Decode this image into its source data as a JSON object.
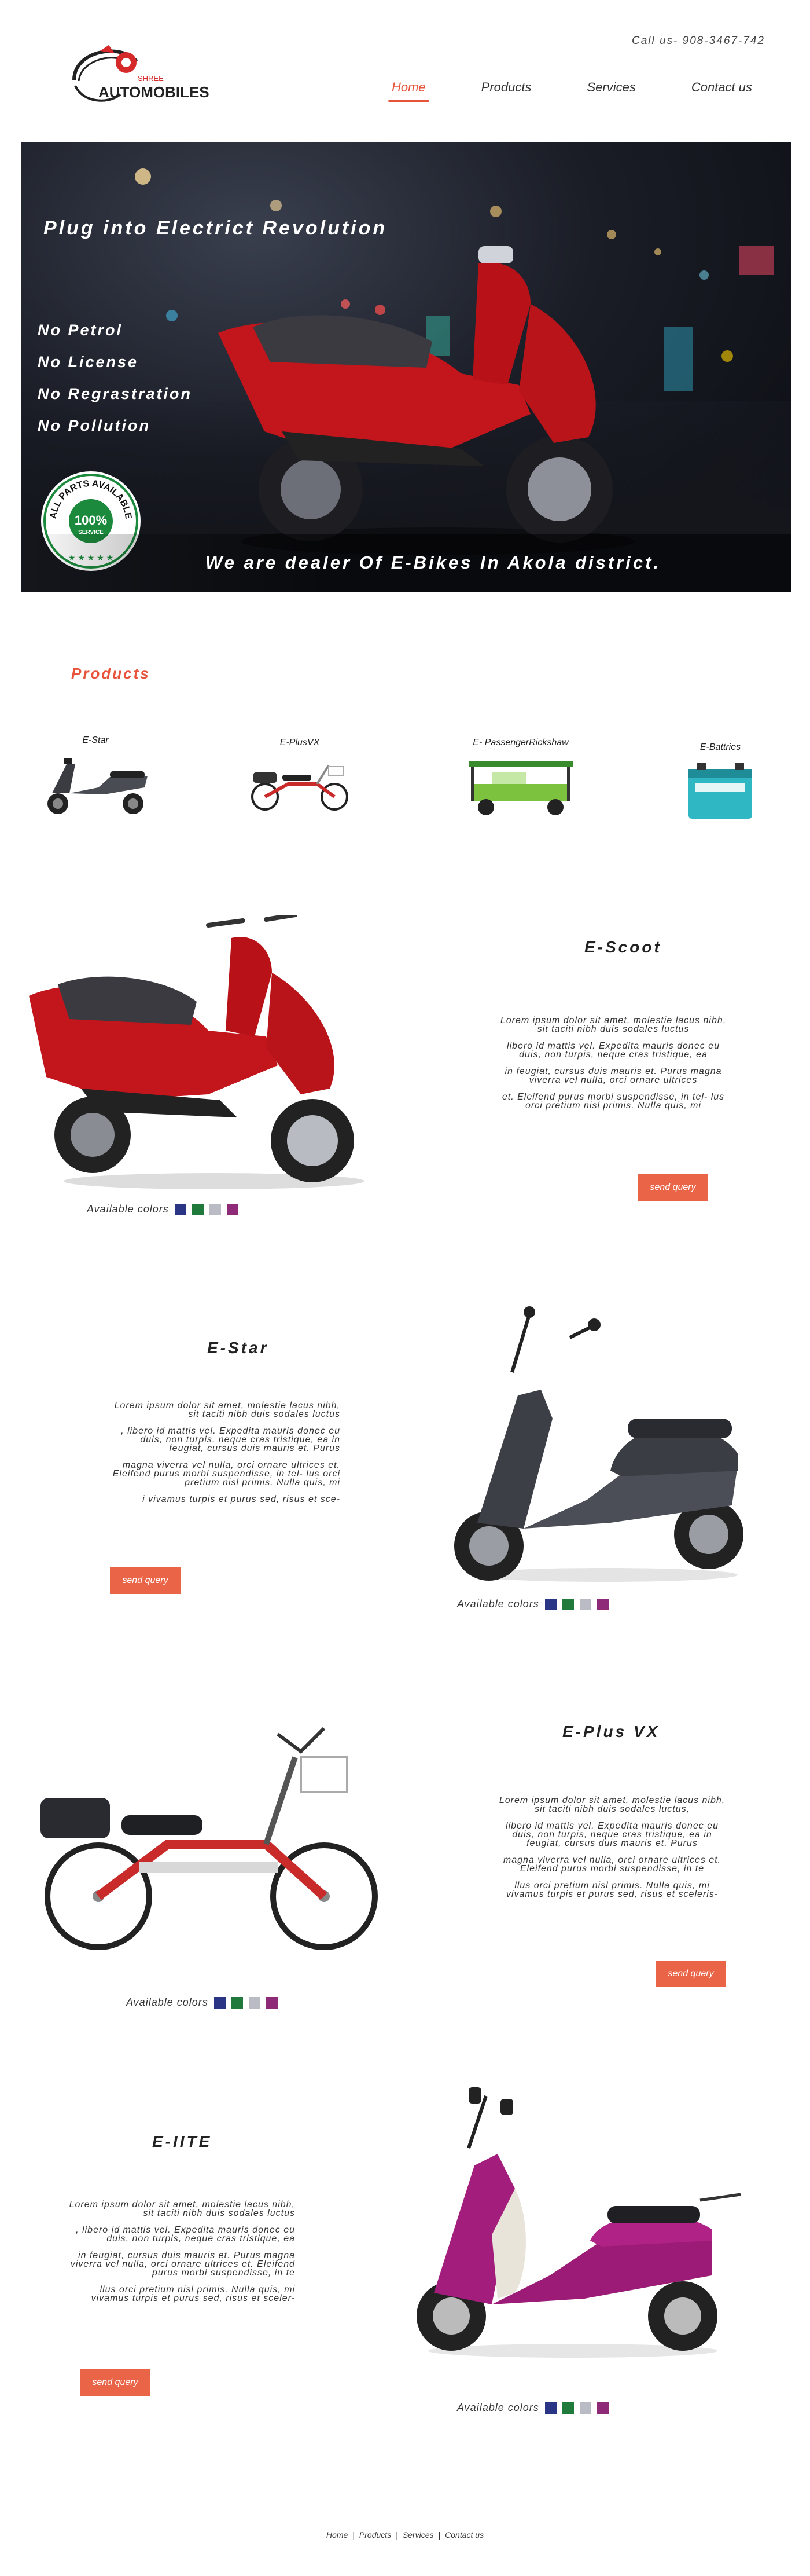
{
  "brand": {
    "top": "SHREE",
    "name": "AUTOMOBILES"
  },
  "contact": "Call us- 908-3467-742",
  "nav": [
    {
      "label": "Home",
      "active": true
    },
    {
      "label": "Products",
      "active": false
    },
    {
      "label": "Services",
      "active": false
    },
    {
      "label": "Contact us",
      "active": false
    }
  ],
  "hero": {
    "tagline": "Plug into Electrict Revolution",
    "points": [
      "No Petrol",
      "No License",
      "No Regrastration",
      "No Pollution"
    ],
    "badge": {
      "top": "ALL PARTS AVAILABLE",
      "value": "100%",
      "bottom": "SERVICE"
    },
    "banner": "We are dealer Of E-Bikes In Akola district."
  },
  "products": {
    "title": "Products",
    "items": [
      {
        "label": "E-Star"
      },
      {
        "label": "E-PlusVX"
      },
      {
        "label": "E- PassengerRickshaw"
      },
      {
        "label": "E-Battries"
      }
    ]
  },
  "features": [
    {
      "title": "E-Scoot",
      "paragraphs": [
        "Lorem ipsum dolor sit amet, molestie lacus nibh, sit taciti nibh duis sodales luctus",
        "libero id mattis vel. Expedita mauris donec eu duis, non turpis, neque cras tristique, ea",
        "in feugiat, cursus duis mauris et. Purus magna viverra vel nulla, orci ornare ultrices",
        "et. Eleifend purus morbi suspendisse, in tel- lus orci pretium nisl primis. Nulla quis, mi"
      ],
      "button": "send query",
      "colors_label": "Available colors"
    },
    {
      "title": "E-Star",
      "paragraphs": [
        "Lorem ipsum dolor sit amet, molestie lacus nibh, sit taciti nibh duis sodales luctus",
        ", libero id mattis vel. Expedita mauris donec eu duis, non turpis, neque cras tristique, ea in feugiat, cursus duis mauris et. Purus",
        "magna viverra vel nulla, orci ornare ultrices et. Eleifend purus morbi suspendisse, in tel- lus orci pretium nisl primis. Nulla quis, mi",
        "i vivamus turpis et purus sed, risus et sce-"
      ],
      "button": "send query",
      "colors_label": "Available colors"
    },
    {
      "title": "E-Plus VX",
      "paragraphs": [
        "Lorem ipsum dolor sit amet, molestie lacus nibh, sit taciti nibh duis sodales luctus,",
        "libero id mattis vel. Expedita mauris donec eu duis, non turpis, neque cras tristique, ea in feugiat, cursus duis mauris et. Purus",
        "magna viverra vel nulla, orci ornare ultrices et. Eleifend purus morbi suspendisse, in te",
        "llus orci pretium nisl primis. Nulla quis, mi vivamus turpis et purus sed, risus et sceleris-"
      ],
      "button": "send query",
      "colors_label": "Available colors"
    },
    {
      "title": "E-IITE",
      "paragraphs": [
        "Lorem ipsum dolor sit amet, molestie lacus nibh, sit taciti nibh duis sodales luctus",
        ", libero id mattis vel. Expedita mauris donec eu duis, non turpis, neque cras tristique, ea",
        "in feugiat, cursus duis mauris et. Purus magna viverra vel nulla, orci ornare ultrices et. Eleifend purus morbi suspendisse, in te",
        "llus orci pretium nisl primis. Nulla quis, mi vivamus turpis et purus sed, risus et sceler-"
      ],
      "button": "send query",
      "colors_label": "Available colors"
    }
  ],
  "swatches": [
    "#2a3585",
    "#1f7a3c",
    "#b9bcc4",
    "#8e2a78"
  ],
  "footer": [
    "Home",
    "Products",
    "Services",
    "Contact us"
  ],
  "footer_sep": "|"
}
